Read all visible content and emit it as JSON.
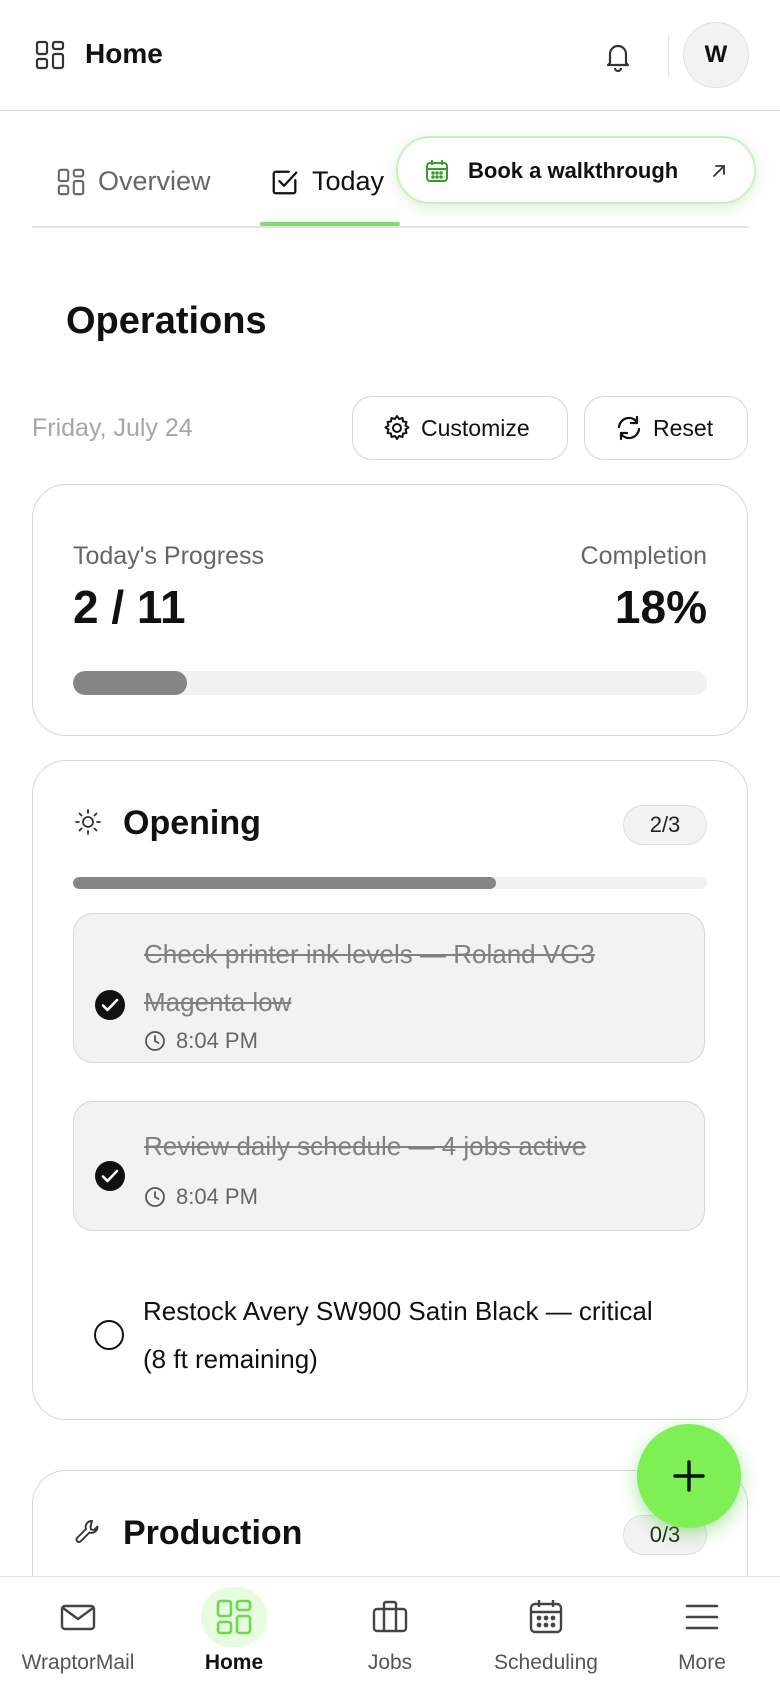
{
  "header": {
    "title": "Home",
    "avatar_initial": "W"
  },
  "tabs": [
    {
      "label": "Overview",
      "active": false
    },
    {
      "label": "Today",
      "active": true
    }
  ],
  "walkthrough": {
    "label": "Book a walkthrough"
  },
  "operations": {
    "title": "Operations",
    "date": "Friday, July 24",
    "customize_label": "Customize",
    "reset_label": "Reset"
  },
  "progress": {
    "label": "Today's Progress",
    "value": "2 / 11",
    "completion_label": "Completion",
    "completion_value": "18%",
    "fraction": 0.18
  },
  "opening": {
    "title": "Opening",
    "count": "2/3",
    "fraction": 0.667,
    "tasks": [
      {
        "text": "Check printer ink levels — Roland VG3 Magenta low",
        "time": "8:04 PM",
        "done": true
      },
      {
        "text": "Review daily schedule — 4 jobs active",
        "time": "8:04 PM",
        "done": true
      },
      {
        "text": "Restock Avery SW900 Satin Black — critical (8 ft remaining)",
        "done": false
      }
    ]
  },
  "production": {
    "title": "Production",
    "count": "0/3"
  },
  "bottom_nav": [
    {
      "label": "WraptorMail",
      "icon": "mail-icon",
      "active": false
    },
    {
      "label": "Home",
      "icon": "grid-icon",
      "active": true
    },
    {
      "label": "Jobs",
      "icon": "briefcase-icon",
      "active": false
    },
    {
      "label": "Scheduling",
      "icon": "calendar-icon",
      "active": false
    },
    {
      "label": "More",
      "icon": "menu-icon",
      "active": false
    }
  ],
  "colors": {
    "accent_green": "#7ef054",
    "progress_fill": "#858585",
    "track": "#f1f1f1"
  }
}
